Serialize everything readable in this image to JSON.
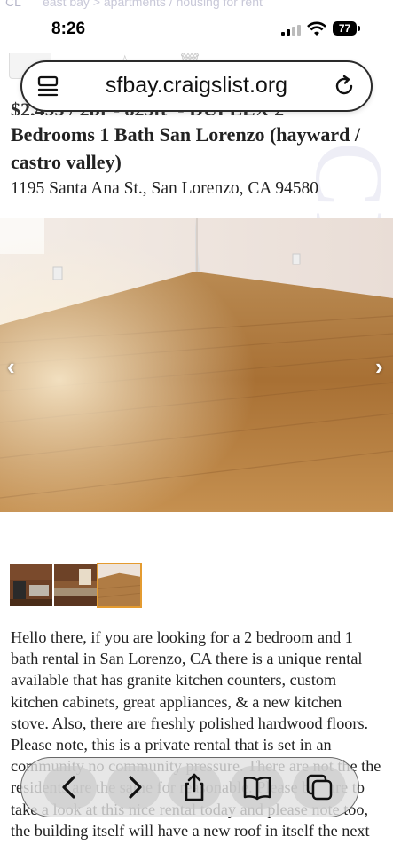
{
  "status_bar": {
    "time": "8:26",
    "battery": "77"
  },
  "top_faded": {
    "logo": "CL",
    "breadcrumbs": "east bay > apartments / housing for rent"
  },
  "address_bar": {
    "url": "sfbay.craigslist.org"
  },
  "listing": {
    "title_partial": "$2,495 / 2br - 825ft² - DUPLEX 2",
    "title_rest": "Bedrooms 1 Bath San Lorenzo (hayward / castro valley)",
    "address": "1195 Santa Ana St., San Lorenzo, CA 94580",
    "photo_prev": "‹",
    "photo_next": "›",
    "description": "Hello there, if you are looking for a 2 bedroom and 1 bath rental in San Lorenzo, CA there is a unique rental available that has granite kitchen counters, custom kitchen cabinets, great appliances, & a new kitchen stove. Also, there are freshly polished hardwood floors. Please note, this is a private rental that is set in an community no community pressure. There are not the the residents are the same for reasonable. Please be sure to take a look at this nice rental today and please note too, the building itself will have a new roof in itself the next"
  },
  "thumbnails": [
    {
      "name": "kitchen-photo-1"
    },
    {
      "name": "kitchen-photo-2"
    },
    {
      "name": "floor-photo",
      "selected": true
    }
  ],
  "toolbar": {
    "buttons": [
      {
        "icon": "back-icon"
      },
      {
        "icon": "forward-icon"
      },
      {
        "icon": "share-icon"
      },
      {
        "icon": "bookmarks-icon"
      },
      {
        "icon": "tabs-icon"
      }
    ]
  },
  "colors": {
    "accent_selected": "#e49b30",
    "watermark": "#eeeef6"
  }
}
